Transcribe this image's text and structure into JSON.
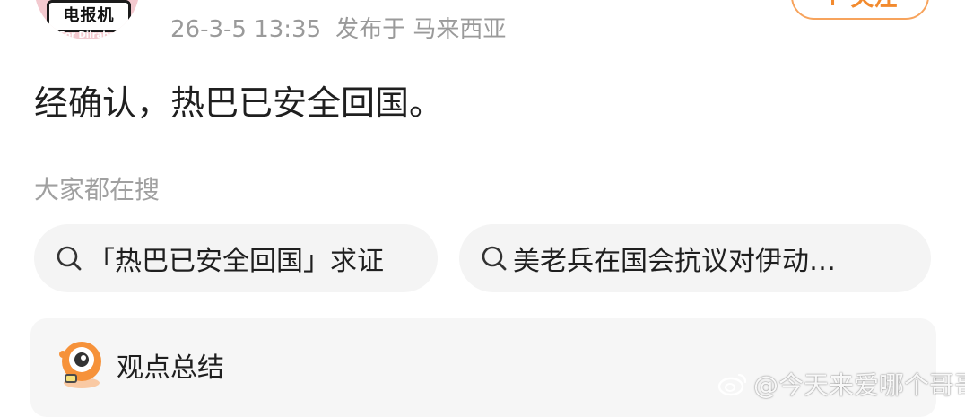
{
  "header": {
    "avatar_logo_text": "电报机",
    "avatar_logo_subtext": "For Dilraba",
    "timestamp": "26-3-5 13:35",
    "location": "发布于 马来西亚",
    "follow_label": "+ 关注"
  },
  "post": {
    "text": "经确认，热巴已安全回国。"
  },
  "search_section": {
    "title": "大家都在搜",
    "chips": [
      {
        "label": "「热巴已安全回国」求证",
        "icon": "search-icon"
      },
      {
        "label": "美老兵在国会抗议对伊动…",
        "icon": "search-icon"
      }
    ]
  },
  "summary": {
    "title": "观点总结",
    "icon": "mascot-icon"
  },
  "watermark": {
    "text": "@今天来爱哪个哥哥",
    "icon": "weibo-icon"
  },
  "colors": {
    "accent": "#f28a2e",
    "meta_gray": "#9a9a9a",
    "chip_bg": "#f4f4f4",
    "card_bg": "#f6f6f6"
  }
}
